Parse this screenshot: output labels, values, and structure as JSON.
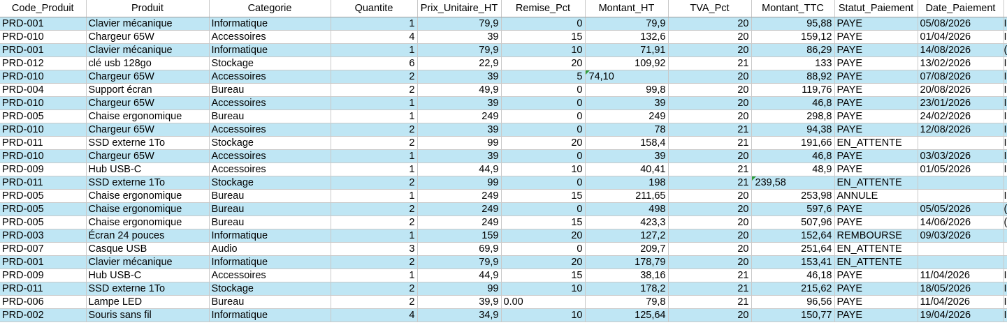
{
  "headers": [
    "Code_Produit",
    "Produit",
    "Categorie",
    "Quantite",
    "Prix_Unitaire_HT",
    "Remise_Pct",
    "Montant_HT",
    "TVA_Pct",
    "Montant_TTC",
    "Statut_Paiement",
    "Date_Paiement",
    ""
  ],
  "rows": [
    {
      "style": "blue",
      "cells": [
        "PRD-001",
        "Clavier mécanique",
        "Informatique",
        "1",
        "79,9",
        "0",
        "79,9",
        "20",
        "95,88",
        "PAYE",
        "05/08/2026",
        "I"
      ]
    },
    {
      "style": "white",
      "cells": [
        "PRD-010",
        "Chargeur 65W",
        "Accessoires",
        "4",
        "39",
        "15",
        "132,6",
        "20",
        "159,12",
        "PAYE",
        "01/04/2026",
        "I"
      ]
    },
    {
      "style": "blue",
      "cells": [
        "PRD-001",
        "Clavier mécanique",
        "Informatique",
        "1",
        "79,9",
        "10",
        "71,91",
        "20",
        "86,29",
        "PAYE",
        "14/08/2026",
        "("
      ]
    },
    {
      "style": "white",
      "cells": [
        "PRD-012",
        "clé usb 128go",
        "Stockage",
        "6",
        "22,9",
        "20",
        "109,92",
        "21",
        "133",
        "PAYE",
        "13/02/2026",
        "I"
      ]
    },
    {
      "style": "blue",
      "cells": [
        "PRD-010",
        "Chargeur 65W",
        "Accessoires",
        "2",
        "39",
        "5",
        "",
        "20",
        "88,92",
        "PAYE",
        "07/08/2026",
        "I"
      ],
      "spill": {
        "col": 6,
        "text": "74,10"
      }
    },
    {
      "style": "white",
      "cells": [
        "PRD-004",
        "Support écran",
        "Bureau",
        "2",
        "49,9",
        "0",
        "99,8",
        "20",
        "119,76",
        "PAYE",
        "20/08/2026",
        "I"
      ]
    },
    {
      "style": "blue",
      "cells": [
        "PRD-010",
        "Chargeur 65W",
        "Accessoires",
        "1",
        "39",
        "0",
        "39",
        "20",
        "46,8",
        "PAYE",
        "23/01/2026",
        "I"
      ]
    },
    {
      "style": "white",
      "cells": [
        "PRD-005",
        "Chaise ergonomique",
        "Bureau",
        "1",
        "249",
        "0",
        "249",
        "20",
        "298,8",
        "PAYE",
        "24/02/2026",
        "I"
      ]
    },
    {
      "style": "blue",
      "cells": [
        "PRD-010",
        "Chargeur 65W",
        "Accessoires",
        "2",
        "39",
        "0",
        "78",
        "21",
        "94,38",
        "PAYE",
        "12/08/2026",
        "I"
      ]
    },
    {
      "style": "white",
      "cells": [
        "PRD-011",
        "SSD externe 1To",
        "Stockage",
        "2",
        "99",
        "20",
        "158,4",
        "21",
        "191,66",
        "EN_ATTENTE",
        "",
        "I"
      ]
    },
    {
      "style": "blue",
      "cells": [
        "PRD-010",
        "Chargeur 65W",
        "Accessoires",
        "1",
        "39",
        "0",
        "39",
        "20",
        "46,8",
        "PAYE",
        "03/03/2026",
        "I"
      ]
    },
    {
      "style": "white",
      "cells": [
        "PRD-009",
        "Hub USB-C",
        "Accessoires",
        "1",
        "44,9",
        "10",
        "40,41",
        "21",
        "48,9",
        "PAYE",
        "01/05/2026",
        "I"
      ]
    },
    {
      "style": "blue",
      "cells": [
        "PRD-011",
        "SSD externe 1To",
        "Stockage",
        "2",
        "99",
        "0",
        "198",
        "21",
        "",
        "EN_ATTENTE",
        "",
        ""
      ],
      "spill": {
        "col": 8,
        "text": "239,58"
      }
    },
    {
      "style": "white",
      "cells": [
        "PRD-005",
        "Chaise ergonomique",
        "Bureau",
        "1",
        "249",
        "15",
        "211,65",
        "20",
        "253,98",
        "ANNULE",
        "",
        "I"
      ]
    },
    {
      "style": "blue",
      "cells": [
        "PRD-005",
        "Chaise ergonomique",
        "Bureau",
        "2",
        "249",
        "0",
        "498",
        "20",
        "597,6",
        "PAYE",
        "05/05/2026",
        "("
      ]
    },
    {
      "style": "white",
      "cells": [
        "PRD-005",
        "Chaise ergonomique",
        "Bureau",
        "2",
        "249",
        "15",
        "423,3",
        "20",
        "507,96",
        "PAYE",
        "14/06/2026",
        "("
      ]
    },
    {
      "style": "blue",
      "cells": [
        "PRD-003",
        "Écran 24 pouces",
        "Informatique",
        "1",
        "159",
        "20",
        "127,2",
        "20",
        "152,64",
        "REMBOURSE",
        "09/03/2026",
        ""
      ]
    },
    {
      "style": "white",
      "cells": [
        "PRD-007",
        "Casque USB",
        "Audio",
        "3",
        "69,9",
        "0",
        "209,7",
        "20",
        "251,64",
        "EN_ATTENTE",
        "",
        ""
      ]
    },
    {
      "style": "blue",
      "cells": [
        "PRD-001",
        "Clavier mécanique",
        "Informatique",
        "2",
        "79,9",
        "20",
        "178,79",
        "20",
        "153,41",
        "EN_ATTENTE",
        "",
        ""
      ]
    },
    {
      "style": "white",
      "cells": [
        "PRD-009",
        "Hub USB-C",
        "Accessoires",
        "1",
        "44,9",
        "15",
        "38,16",
        "21",
        "46,18",
        "PAYE",
        "11/04/2026",
        "I"
      ]
    },
    {
      "style": "blue",
      "cells": [
        "PRD-011",
        "SSD externe 1To",
        "Stockage",
        "2",
        "99",
        "10",
        "178,2",
        "21",
        "215,62",
        "PAYE",
        "18/05/2026",
        "I"
      ]
    },
    {
      "style": "white",
      "cells": [
        "PRD-006",
        "Lampe LED",
        "Bureau",
        "2",
        "39,9",
        "0.00",
        "79,8",
        "21",
        "96,56",
        "PAYE",
        "11/04/2026",
        "I"
      ]
    },
    {
      "style": "blue",
      "cells": [
        "PRD-002",
        "Souris sans fil",
        "Informatique",
        "4",
        "34,9",
        "10",
        "125,64",
        "20",
        "150,77",
        "PAYE",
        "19/04/2026",
        "I"
      ]
    }
  ],
  "align": [
    "l",
    "l",
    "l",
    "r",
    "r",
    "r",
    "r",
    "r",
    "r",
    "l",
    "l",
    "l"
  ],
  "overrides": [
    {
      "row": 21,
      "col": 5,
      "align": "l"
    }
  ],
  "colors": {
    "band": "#bfe6f4",
    "grid": "#c9c9c9",
    "flag": "#2e9e3e"
  }
}
